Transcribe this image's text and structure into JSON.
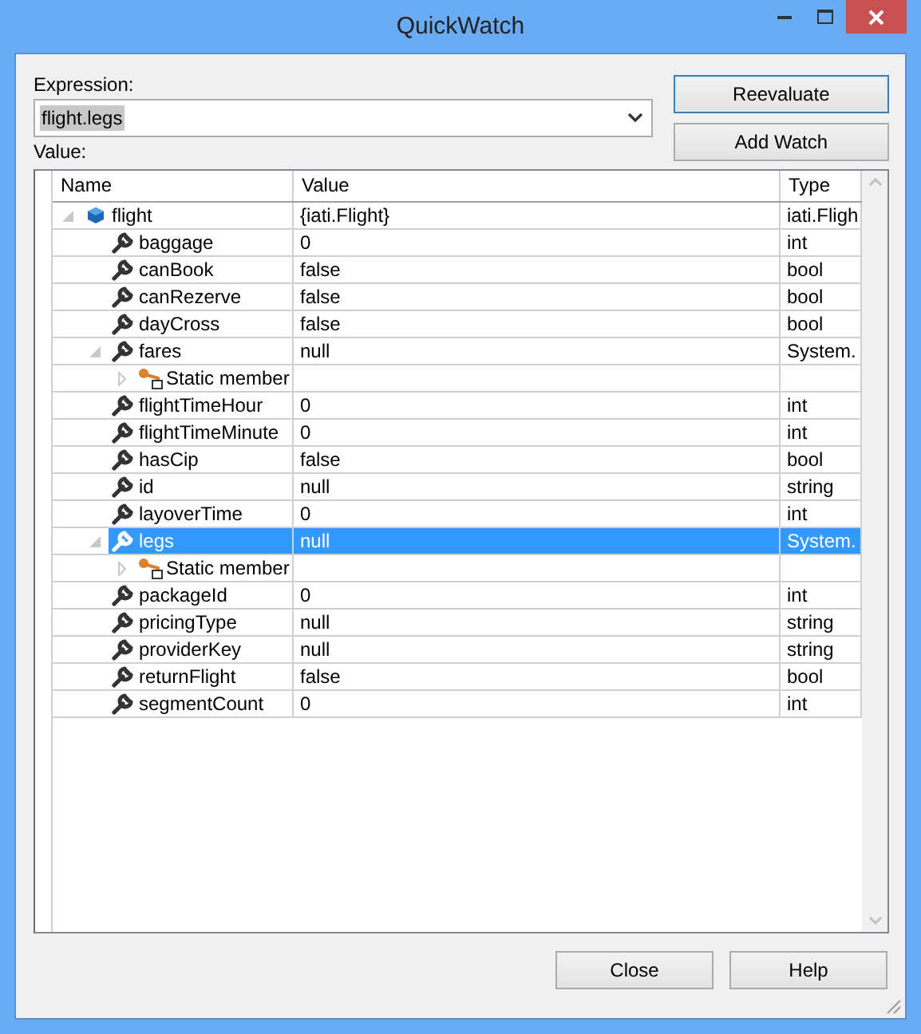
{
  "window": {
    "title": "QuickWatch"
  },
  "expression": {
    "label": "Expression:",
    "value": "flight.legs",
    "text_selected": true
  },
  "side_buttons": [
    {
      "label": "Reevaluate",
      "default": true
    },
    {
      "label": "Add Watch",
      "default": false
    }
  ],
  "value_label": "Value:",
  "watch": {
    "columns": [
      "Name",
      "Value",
      "Type"
    ],
    "rows": [
      {
        "kind": "object",
        "name": "flight",
        "value": "{iati.Flight}",
        "type": "iati.Fligh",
        "expanded": true,
        "selected": false,
        "children": [
          {
            "kind": "property",
            "name": "baggage",
            "value": "0",
            "type": "int",
            "selected": false
          },
          {
            "kind": "property",
            "name": "canBook",
            "value": "false",
            "type": "bool",
            "selected": false
          },
          {
            "kind": "property",
            "name": "canRezerve",
            "value": "false",
            "type": "bool",
            "selected": false
          },
          {
            "kind": "property",
            "name": "dayCross",
            "value": "false",
            "type": "bool",
            "selected": false
          },
          {
            "kind": "property",
            "name": "fares",
            "value": "null",
            "type": "System.",
            "expanded": true,
            "selected": false,
            "children": [
              {
                "kind": "static",
                "name": "Static member",
                "expanded": false,
                "selected": false
              }
            ]
          },
          {
            "kind": "property",
            "name": "flightTimeHour",
            "value": "0",
            "type": "int",
            "selected": false
          },
          {
            "kind": "property",
            "name": "flightTimeMinute",
            "value": "0",
            "type": "int",
            "selected": false
          },
          {
            "kind": "property",
            "name": "hasCip",
            "value": "false",
            "type": "bool",
            "selected": false
          },
          {
            "kind": "property",
            "name": "id",
            "value": "null",
            "type": "string",
            "selected": false
          },
          {
            "kind": "property",
            "name": "layoverTime",
            "value": "0",
            "type": "int",
            "selected": false
          },
          {
            "kind": "property",
            "name": "legs",
            "value": "null",
            "type": "System.",
            "expanded": true,
            "selected": true,
            "children": [
              {
                "kind": "static",
                "name": "Static member",
                "expanded": false,
                "selected": false
              }
            ]
          },
          {
            "kind": "property",
            "name": "packageId",
            "value": "0",
            "type": "int",
            "selected": false
          },
          {
            "kind": "property",
            "name": "pricingType",
            "value": "null",
            "type": "string",
            "selected": false
          },
          {
            "kind": "property",
            "name": "providerKey",
            "value": "null",
            "type": "string",
            "selected": false
          },
          {
            "kind": "property",
            "name": "returnFlight",
            "value": "false",
            "type": "bool",
            "selected": false
          },
          {
            "kind": "property",
            "name": "segmentCount",
            "value": "0",
            "type": "int",
            "selected": false
          }
        ]
      }
    ]
  },
  "bottom_buttons": [
    "Close",
    "Help"
  ]
}
